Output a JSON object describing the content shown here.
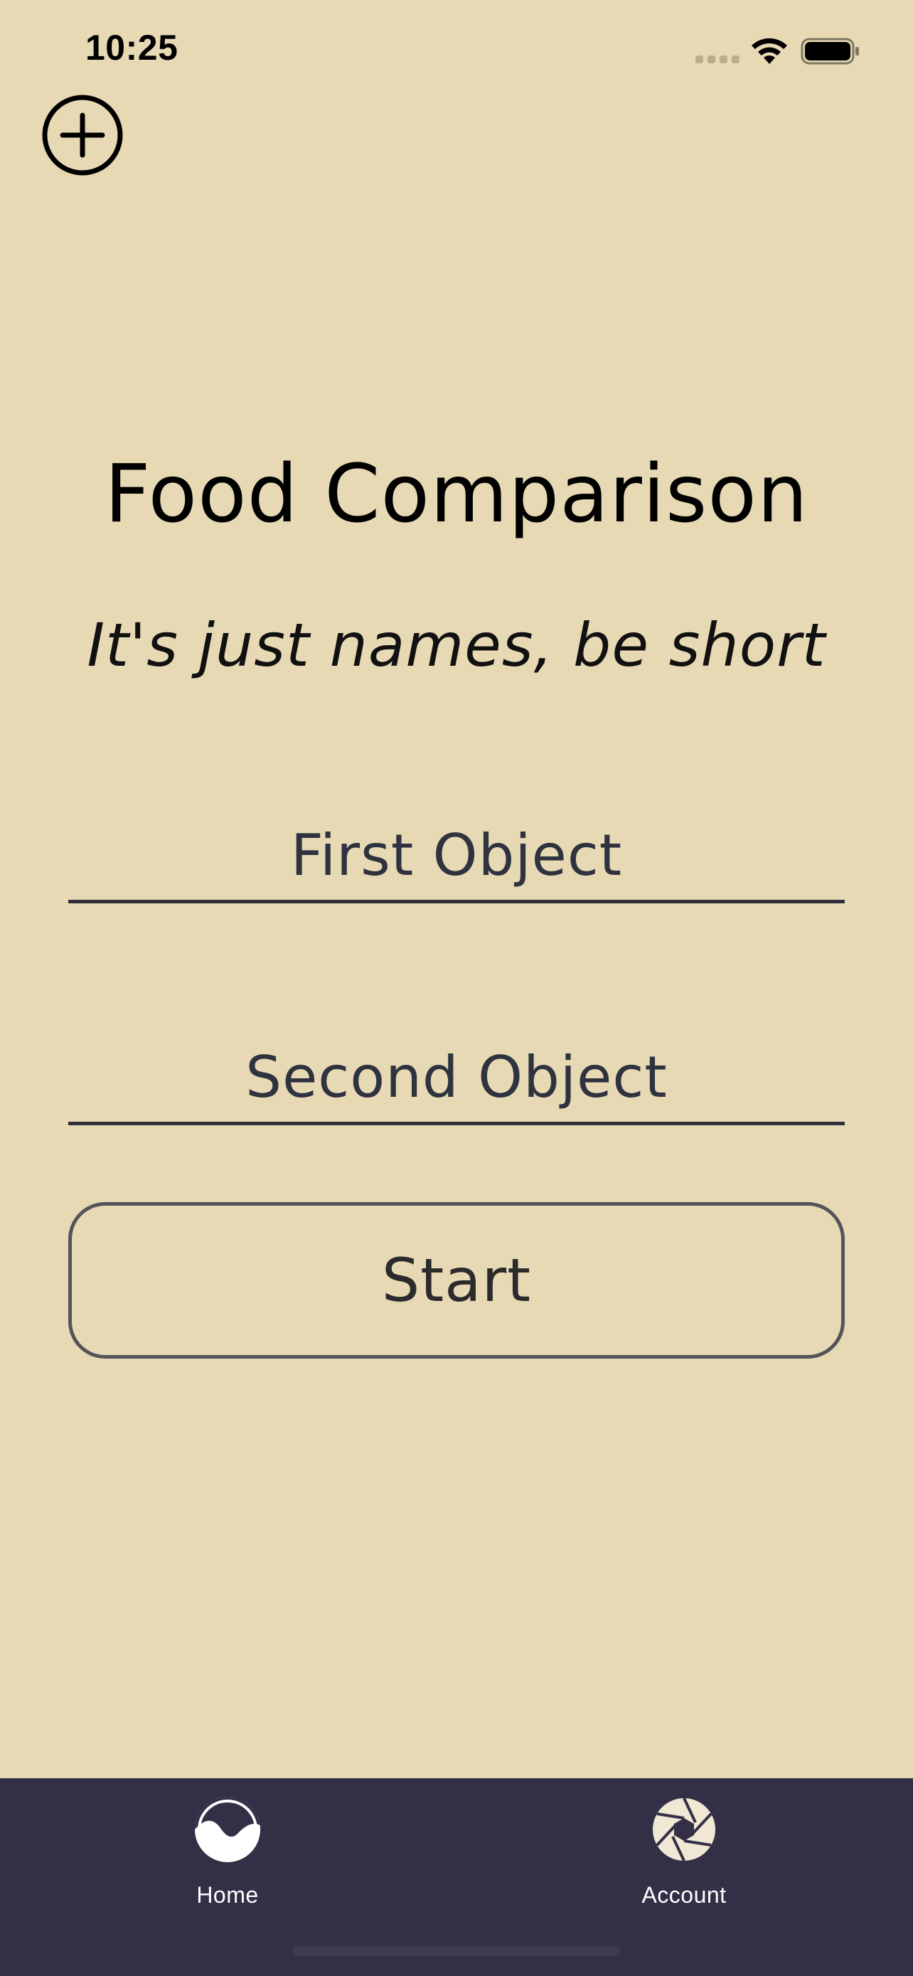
{
  "status_bar": {
    "time": "10:25"
  },
  "header": {
    "add_icon": "plus-circle-icon"
  },
  "main": {
    "title": "Food Comparison",
    "subtitle": "It's just names, be short",
    "first_input": {
      "placeholder": "First Object",
      "value": ""
    },
    "second_input": {
      "placeholder": "Second Object",
      "value": ""
    },
    "start_label": "Start"
  },
  "tab_bar": {
    "items": [
      {
        "label": "Home",
        "icon": "home-wave-icon"
      },
      {
        "label": "Account",
        "icon": "aperture-icon"
      }
    ]
  },
  "colors": {
    "background": "#e7d9b4",
    "tab_bar": "#332f47",
    "text_dark": "#2f2f3a"
  }
}
